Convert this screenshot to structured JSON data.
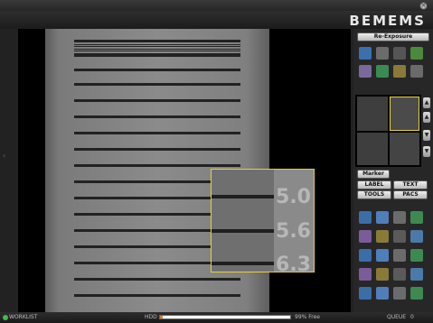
{
  "brand": "BEMEMS",
  "window": {
    "close_icon": "close-icon"
  },
  "viewer": {
    "zoom_labels": [
      "5.0",
      "5.6",
      "6.3"
    ],
    "accent_color": "#e3d23b",
    "side_marker": "‹"
  },
  "panel": {
    "re_exposure": "Re-Exposure",
    "marker": "Marker",
    "label": "LABEL",
    "text": "TEXT",
    "tools": "TOOLS",
    "pacs": "PACS",
    "tool_icons_row1": [
      "pointer-icon",
      "ruler-icon",
      "angle-icon",
      "pen-icon"
    ],
    "tool_icons_row2": [
      "rotate-icon",
      "flip-icon",
      "contrast-icon",
      "bucket-icon"
    ],
    "grid_icons": [
      [
        "layout-grid-icon",
        "layout-split-icon",
        "layout-quad-icon",
        "refresh-icon"
      ],
      [
        "zoom-in-icon",
        "search-icon",
        "magnify-icon",
        "user-icon"
      ],
      [
        "image-icon",
        "photo-icon",
        "stack-icon",
        "book-icon"
      ],
      [
        "brightness-icon",
        "palette-icon",
        "erase-icon",
        "check-icon"
      ],
      [
        "hand-icon",
        "tag-icon",
        "arrow-icon",
        "export-icon"
      ]
    ],
    "arrows": [
      "▲",
      "▲",
      "▼",
      "▼"
    ]
  },
  "status": {
    "worklist": "WORKLIST",
    "hdd_label": "HDD",
    "hdd_used_percent": 99,
    "hdd_free": "99% Free",
    "queue_label": "QUEUE",
    "queue_value": "0"
  }
}
